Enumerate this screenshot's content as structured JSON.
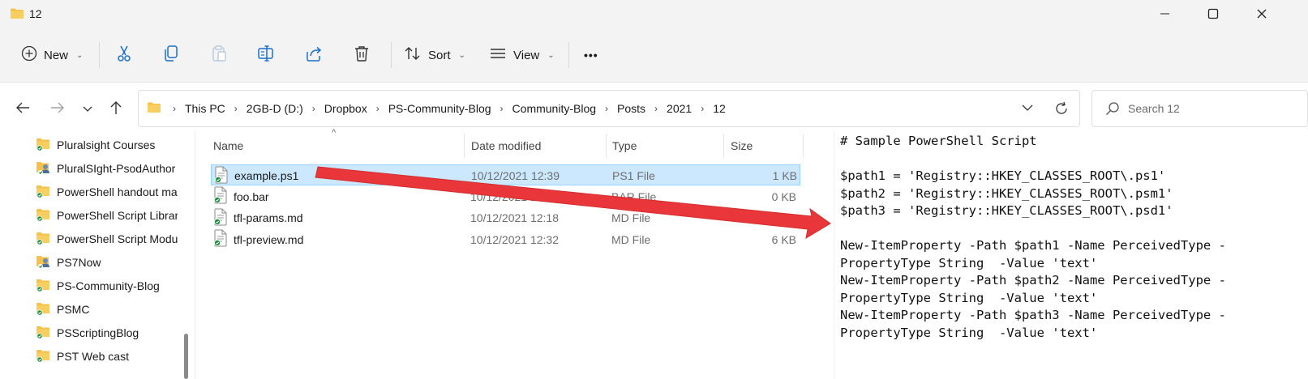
{
  "window": {
    "title": "12"
  },
  "toolbar": {
    "new_label": "New",
    "sort_label": "Sort",
    "view_label": "View",
    "more_label": "•••"
  },
  "address": {
    "crumbs": [
      "This PC",
      "2GB-D (D:)",
      "Dropbox",
      "PS-Community-Blog",
      "Community-Blog",
      "Posts",
      "2021",
      "12"
    ]
  },
  "search": {
    "placeholder": "Search 12"
  },
  "nav": {
    "items": [
      {
        "label": "Pluralsight Courses",
        "icon": "folder-sync-icon"
      },
      {
        "label": "PluralSIght-PsodAuthor",
        "icon": "shared-folder-icon"
      },
      {
        "label": "PowerShell handout ma",
        "icon": "folder-sync-icon"
      },
      {
        "label": "PowerShell Script Librar",
        "icon": "folder-sync-icon"
      },
      {
        "label": "PowerShell Script Modu",
        "icon": "folder-sync-icon"
      },
      {
        "label": "PS7Now",
        "icon": "shared-folder-icon"
      },
      {
        "label": "PS-Community-Blog",
        "icon": "folder-sync-icon"
      },
      {
        "label": "PSMC",
        "icon": "folder-sync-icon"
      },
      {
        "label": "PSScriptingBlog",
        "icon": "folder-sync-icon"
      },
      {
        "label": "PST Web cast",
        "icon": "folder-sync-icon"
      }
    ]
  },
  "files": {
    "columns": {
      "name": "Name",
      "date": "Date modified",
      "type": "Type",
      "size": "Size"
    },
    "rows": [
      {
        "name": "example.ps1",
        "date": "10/12/2021 12:39",
        "type": "PS1 File",
        "size": "1 KB",
        "selected": true
      },
      {
        "name": "foo.bar",
        "date": "10/12/2021 12:3",
        "type": "BAR File",
        "size": "0 KB",
        "selected": false
      },
      {
        "name": "tfl-params.md",
        "date": "10/12/2021 12:18",
        "type": "MD File",
        "size": "6 KB",
        "selected": false
      },
      {
        "name": "tfl-preview.md",
        "date": "10/12/2021 12:32",
        "type": "MD File",
        "size": "6 KB",
        "selected": false
      }
    ]
  },
  "preview": {
    "lines": [
      "# Sample PowerShell Script",
      "",
      "$path1 = 'Registry::HKEY_CLASSES_ROOT\\.ps1'",
      "$path2 = 'Registry::HKEY_CLASSES_ROOT\\.psm1'",
      "$path3 = 'Registry::HKEY_CLASSES_ROOT\\.psd1'",
      "",
      "New-ItemProperty -Path $path1 -Name PerceivedType -",
      "PropertyType String  -Value 'text'",
      "New-ItemProperty -Path $path2 -Name PerceivedType -",
      "PropertyType String  -Value 'text'",
      "New-ItemProperty -Path $path3 -Name PerceivedType -",
      "PropertyType String  -Value 'text'"
    ]
  },
  "colors": {
    "accent": "#0067c0",
    "selection": "#cce8ff",
    "folder": "#f4c24b",
    "arrow": "#e8363a"
  }
}
